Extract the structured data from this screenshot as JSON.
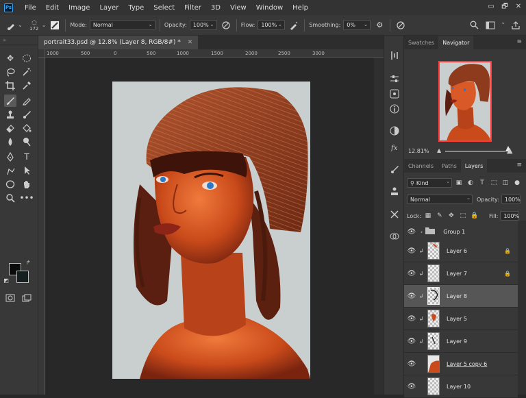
{
  "menubar": {
    "logo": "Ps",
    "items": [
      "File",
      "Edit",
      "Image",
      "Layer",
      "Type",
      "Select",
      "Filter",
      "3D",
      "View",
      "Window",
      "Help"
    ],
    "controls": [
      "▭",
      "🗗",
      "✕"
    ]
  },
  "options": {
    "brush_size": "172",
    "mode_label": "Mode:",
    "mode_value": "Normal",
    "opacity_label": "Opacity:",
    "opacity_value": "100%",
    "flow_label": "Flow:",
    "flow_value": "100%",
    "smoothing_label": "Smoothing:",
    "smoothing_value": "0%"
  },
  "document": {
    "tab_title": "portrait33.psd @ 12.8% (Layer 8, RGB/8#) *",
    "ruler_labels": [
      "1000",
      "500",
      "0",
      "500",
      "1000",
      "1500",
      "2000",
      "2500",
      "3000"
    ]
  },
  "panels": {
    "top_tabs": [
      "Swatches",
      "Navigator"
    ],
    "zoom_value": "12.81%",
    "layer_tabs": [
      "Channels",
      "Paths",
      "Layers"
    ],
    "filter_kind": "Kind",
    "blend_mode": "Normal",
    "opacity_label": "Opacity:",
    "opacity_value": "100%",
    "lock_label": "Lock:",
    "fill_label": "Fill:",
    "fill_value": "100%",
    "layers": [
      {
        "name": "Group 1",
        "type": "group"
      },
      {
        "name": "Layer 6",
        "locked": true
      },
      {
        "name": "Layer 7",
        "locked": true
      },
      {
        "name": "Layer 8",
        "selected": true
      },
      {
        "name": "Layer 5"
      },
      {
        "name": "Layer 9"
      },
      {
        "name": "Layer 5 copy 6"
      },
      {
        "name": "Layer 10"
      }
    ]
  },
  "colors": {
    "accent": "#31a8ff",
    "foreground": "#0b0b0b",
    "background_swatch": "#151f1f",
    "canvas_bg": "#c9cfcf",
    "navigator_frame": "#ff3a3a"
  }
}
